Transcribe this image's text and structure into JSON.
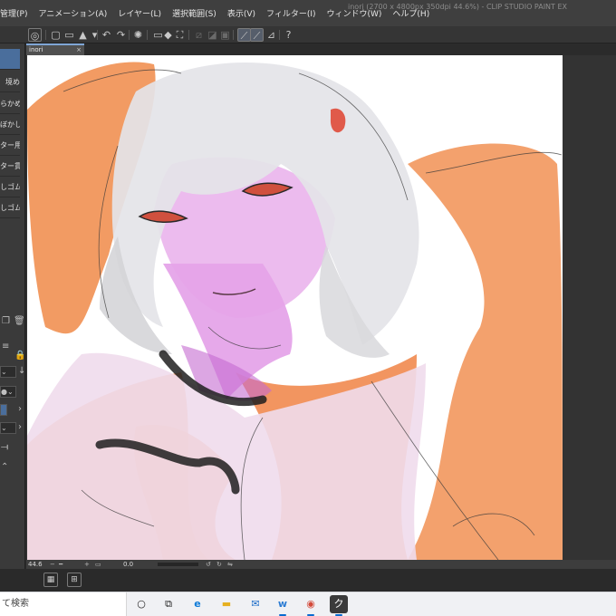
{
  "menu": [
    "管理(P)",
    "アニメーション(A)",
    "レイヤー(L)",
    "選択範囲(S)",
    "表示(V)",
    "フィルター(I)",
    "ウィンドウ(W)",
    "ヘルプ(H)"
  ],
  "window_title": "inori (2700 x 4800px 350dpi 44.6%)  - CLIP STUDIO PAINT EX",
  "document_tab": {
    "name": "inori",
    "close": "×"
  },
  "sub_tools": [
    "",
    "境め",
    "らかめ",
    "ぼかし",
    "ター用",
    "ター貫通",
    "しゴム",
    "しゴム"
  ],
  "status": {
    "zoom": "44.6",
    "angle": "0.0"
  },
  "taskbar": {
    "search_text": "て検索",
    "apps": [
      {
        "name": "cortana",
        "glyph": "○"
      },
      {
        "name": "task-view",
        "glyph": "⧉"
      },
      {
        "name": "edge",
        "glyph": "e"
      },
      {
        "name": "file-explorer",
        "glyph": "▬"
      },
      {
        "name": "mail",
        "glyph": "✉"
      },
      {
        "name": "word",
        "glyph": "w"
      },
      {
        "name": "chrome",
        "glyph": "◉"
      },
      {
        "name": "clip-studio",
        "glyph": "ク"
      }
    ]
  },
  "colors": {
    "menubar": "#3f3f3f",
    "toolbar": "#353535",
    "panel": "#3a3a3a",
    "accent": "#4a6e9c",
    "canvas": "#ffffff",
    "hair": "#e4e4e8",
    "skin": "#e29ae6",
    "cloth": "#f08a48",
    "eye": "#d0503e"
  }
}
